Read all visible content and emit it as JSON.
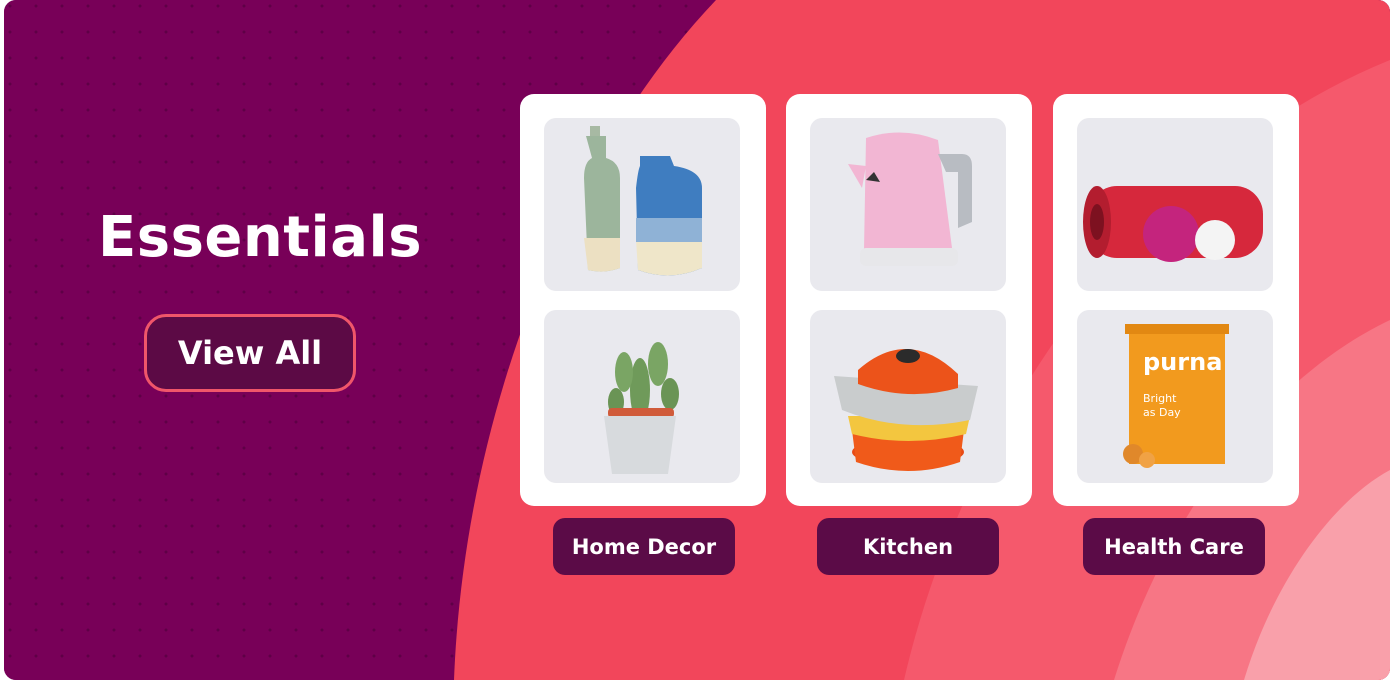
{
  "banner": {
    "title": "Essentials",
    "view_all_label": "View All"
  },
  "categories": [
    {
      "label": "Home Decor",
      "top_image": "vases-icon",
      "bottom_image": "cactus-pot-icon"
    },
    {
      "label": "Kitchen",
      "top_image": "kettle-icon",
      "bottom_image": "cookware-stack-icon"
    },
    {
      "label": "Health Care",
      "top_image": "foam-roller-icon",
      "bottom_image": "supplement-pouch-icon"
    }
  ],
  "product_text": {
    "pouch_brand": "purna",
    "pouch_line1": "Bright",
    "pouch_line2": "as Day"
  },
  "colors": {
    "left_panel": "#780058",
    "right_panel": "#f2475c",
    "label_bg": "#5b0b47",
    "button_border": "#f0566a"
  }
}
